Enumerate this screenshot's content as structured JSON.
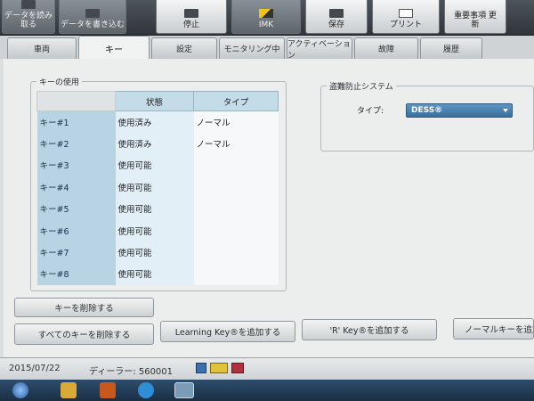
{
  "toolbar": {
    "buttons": [
      {
        "label": "データを読み取る"
      },
      {
        "label": "データを書き込む"
      },
      {
        "label": "停止"
      },
      {
        "label": "IMK"
      },
      {
        "label": "保存"
      },
      {
        "label": "プリント"
      },
      {
        "label": "重要事項 更新"
      }
    ]
  },
  "tabs": [
    "車両",
    "キー",
    "設定",
    "モニタリング中",
    "アクティベーション",
    "故障",
    "履歴"
  ],
  "keys_section": {
    "title": "キーの使用",
    "columns": [
      "状態",
      "タイプ"
    ],
    "rows": [
      {
        "key": "キー#1",
        "status": "使用済み",
        "type": "ノーマル"
      },
      {
        "key": "キー#2",
        "status": "使用済み",
        "type": "ノーマル"
      },
      {
        "key": "キー#3",
        "status": "使用可能",
        "type": ""
      },
      {
        "key": "キー#4",
        "status": "使用可能",
        "type": ""
      },
      {
        "key": "キー#5",
        "status": "使用可能",
        "type": ""
      },
      {
        "key": "キー#6",
        "status": "使用可能",
        "type": ""
      },
      {
        "key": "キー#7",
        "status": "使用可能",
        "type": ""
      },
      {
        "key": "キー#8",
        "status": "使用可能",
        "type": ""
      }
    ]
  },
  "immobilizer": {
    "title": "盗難防止システム",
    "type_label": "タイプ:",
    "type_value": "DESS®"
  },
  "buttons": {
    "delete_key": "キーを削除する",
    "delete_all": "すべてのキーを削除する",
    "add_learning": "Learning Key®を追加する",
    "add_r": "'R' Key®を追加する",
    "add_normal": "ノーマルキーを追加"
  },
  "status": {
    "date": "2015/07/22",
    "dealer": "ディーラー: 560001"
  },
  "colors": {
    "accent": "#4a82b0",
    "row_header": "#b8d4e4",
    "toolbar": "#3b4248"
  }
}
